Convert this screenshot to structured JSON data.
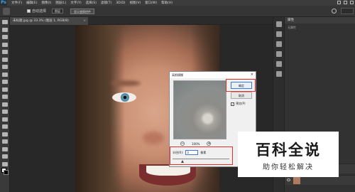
{
  "app": {
    "logo": "Ps"
  },
  "menu": [
    "文件(F)",
    "编辑(E)",
    "图像(I)",
    "图层(L)",
    "文字(Y)",
    "选择(S)",
    "滤镜(T)",
    "3D(D)",
    "视图(V)",
    "窗口(W)",
    "帮助(H)"
  ],
  "options_bar": {
    "checkbox_label": "自动选择",
    "target_value": "图层",
    "button_label": "显示变换控件",
    "workspace_label": "基本功能"
  },
  "document": {
    "tab_label": "未标题.jpg @ 33.3% (图层 1, RGB/8)",
    "close_glyph": "×"
  },
  "dialog": {
    "title": "高斯模糊",
    "close_glyph": "×",
    "ok_label": "确定",
    "cancel_label": "取消",
    "preview_label": "预览(P)",
    "preview_checked_glyph": "✓",
    "zoom_out_glyph": "−",
    "zoom_in_glyph": "+",
    "zoom_value": "100%",
    "radius_label": "半径(R):",
    "radius_value": "3",
    "radius_unit": "像素",
    "slider_value_fraction": 0.18
  },
  "right_panel": {
    "header": "属性",
    "subheader": "无属性"
  },
  "watermark": {
    "main": "百科全说",
    "sub": "助你轻松解决"
  },
  "colors": {
    "highlight": "#e03030",
    "accent": "#31a8ff"
  }
}
